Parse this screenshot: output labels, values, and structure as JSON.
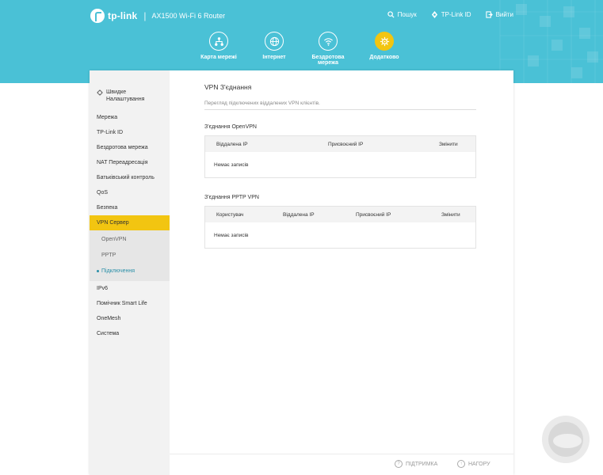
{
  "header": {
    "brand": "tp-link",
    "model": "AX1500 Wi-Fi 6 Router",
    "links": [
      {
        "label": "Пошук",
        "icon": "search-icon"
      },
      {
        "label": "TP-Link ID",
        "icon": "user-icon"
      },
      {
        "label": "Вийти",
        "icon": "logout-icon"
      }
    ],
    "nav": [
      {
        "label": "Карта мережі",
        "icon": "network-map-icon",
        "active": false
      },
      {
        "label": "Інтернет",
        "icon": "globe-icon",
        "active": false
      },
      {
        "label_line1": "Бездротова",
        "label_line2": "мережа",
        "icon": "wifi-icon",
        "active": false
      },
      {
        "label": "Додатково",
        "icon": "gear-icon",
        "active": true
      }
    ],
    "accent_color": "#4ac1d6",
    "active_color": "#f2c511"
  },
  "sidebar": {
    "quick_line1": "Швидке",
    "quick_line2": "Налаштування",
    "items": [
      "Мережа",
      "TP-Link ID",
      "Бездротова мережа",
      "NAT Переадресація",
      "Батьківський контроль",
      "QoS",
      "Безпека",
      "VPN Сервер"
    ],
    "sub_items": [
      "OpenVPN",
      "PPTP",
      "Підключення"
    ],
    "after_items": [
      "IPv6",
      "Помічник Smart Life",
      "OneMesh",
      "Система"
    ]
  },
  "main": {
    "title": "VPN З'єднання",
    "description": "Перегляд підключених віддалених VPN клієнтів.",
    "openvpn": {
      "title": "З'єднання OpenVPN",
      "columns": [
        "Віддалена IP",
        "Присвоєний IP",
        "Змінити"
      ],
      "empty": "Немає записів"
    },
    "pptp": {
      "title": "З'єднання PPTP VPN",
      "columns": [
        "Користувач",
        "Віддалена IP",
        "Присвоєний IP",
        "Змінити"
      ],
      "empty": "Немає записів"
    }
  },
  "footer": {
    "support": "ПІДТРИМКА",
    "top": "НАГОРУ"
  }
}
